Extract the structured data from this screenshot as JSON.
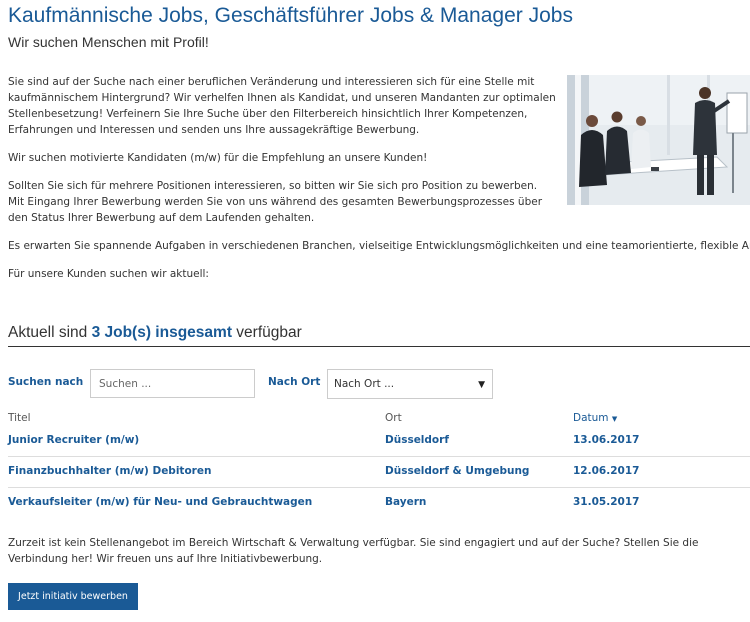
{
  "header": {
    "title": "Kaufmännische Jobs, Geschäftsführer Jobs & Manager Jobs",
    "subtitle": "Wir suchen Menschen mit Profil!"
  },
  "intro": {
    "p1": "Sie sind auf der Suche nach einer beruflichen Veränderung und interessieren sich für eine Stelle mit kaufmännischem Hintergrund? Wir verhelfen Ihnen als Kandidat, und unseren Mandanten zur optimalen Stellenbesetzung! Verfeinern Sie Ihre Suche über den Filterbereich hinsichtlich Ihrer Kompetenzen, Erfahrungen und Interessen und senden uns Ihre aussagekräftige Bewerbung.",
    "p2": "Wir suchen motivierte Kandidaten (m/w) für die Empfehlung an unsere Kunden!",
    "p3": "Sollten Sie sich für mehrere Positionen interessieren, so bitten wir Sie sich pro Position zu bewerben. Mit Eingang Ihrer Bewerbung werden Sie von uns während des gesamten Bewerbungsprozesses über den Status Ihrer Bewerbung auf dem Laufenden gehalten.",
    "p4": "Es erwarten Sie spannende Aufgaben in verschiedenen Branchen, vielseitige Entwicklungsmöglichkeiten und eine teamorientierte, flexible Arbeitsatmosphäre.",
    "p5": "Für unsere Kunden suchen wir aktuell:"
  },
  "jobs_count": {
    "prefix": "Aktuell sind",
    "highlight": "3 Job(s) insgesamt",
    "suffix": "verfügbar"
  },
  "filters": {
    "search_label": "Suchen nach",
    "search_placeholder": "Suchen ...",
    "location_label": "Nach Ort",
    "location_value": "Nach Ort ..."
  },
  "table": {
    "headers": {
      "title": "Titel",
      "location": "Ort",
      "date": "Datum"
    },
    "rows": [
      {
        "title": "Junior Recruiter (m/w)",
        "location": "Düsseldorf",
        "date": "13.06.2017"
      },
      {
        "title": "Finanzbuchhalter (m/w) Debitoren",
        "location": "Düsseldorf & Umgebung",
        "date": "12.06.2017"
      },
      {
        "title": "Verkaufsleiter (m/w) für Neu- und Gebrauchtwagen",
        "location": "Bayern",
        "date": "31.05.2017"
      }
    ]
  },
  "footer": {
    "text": "Zurzeit ist kein Stellenangebot im Bereich Wirtschaft & Verwaltung verfügbar. Sie sind engagiert und auf der Suche? Stellen Sie die Verbindung her! Wir freuen uns auf Ihre Initiativbewerbung.",
    "button_label": "Jetzt initiativ bewerben"
  },
  "icons": {
    "sort": "sort-desc-icon",
    "dropdown": "dropdown-caret-icon"
  },
  "colors": {
    "accent": "#1a5a96",
    "text": "#333333",
    "border": "#cccccc"
  }
}
